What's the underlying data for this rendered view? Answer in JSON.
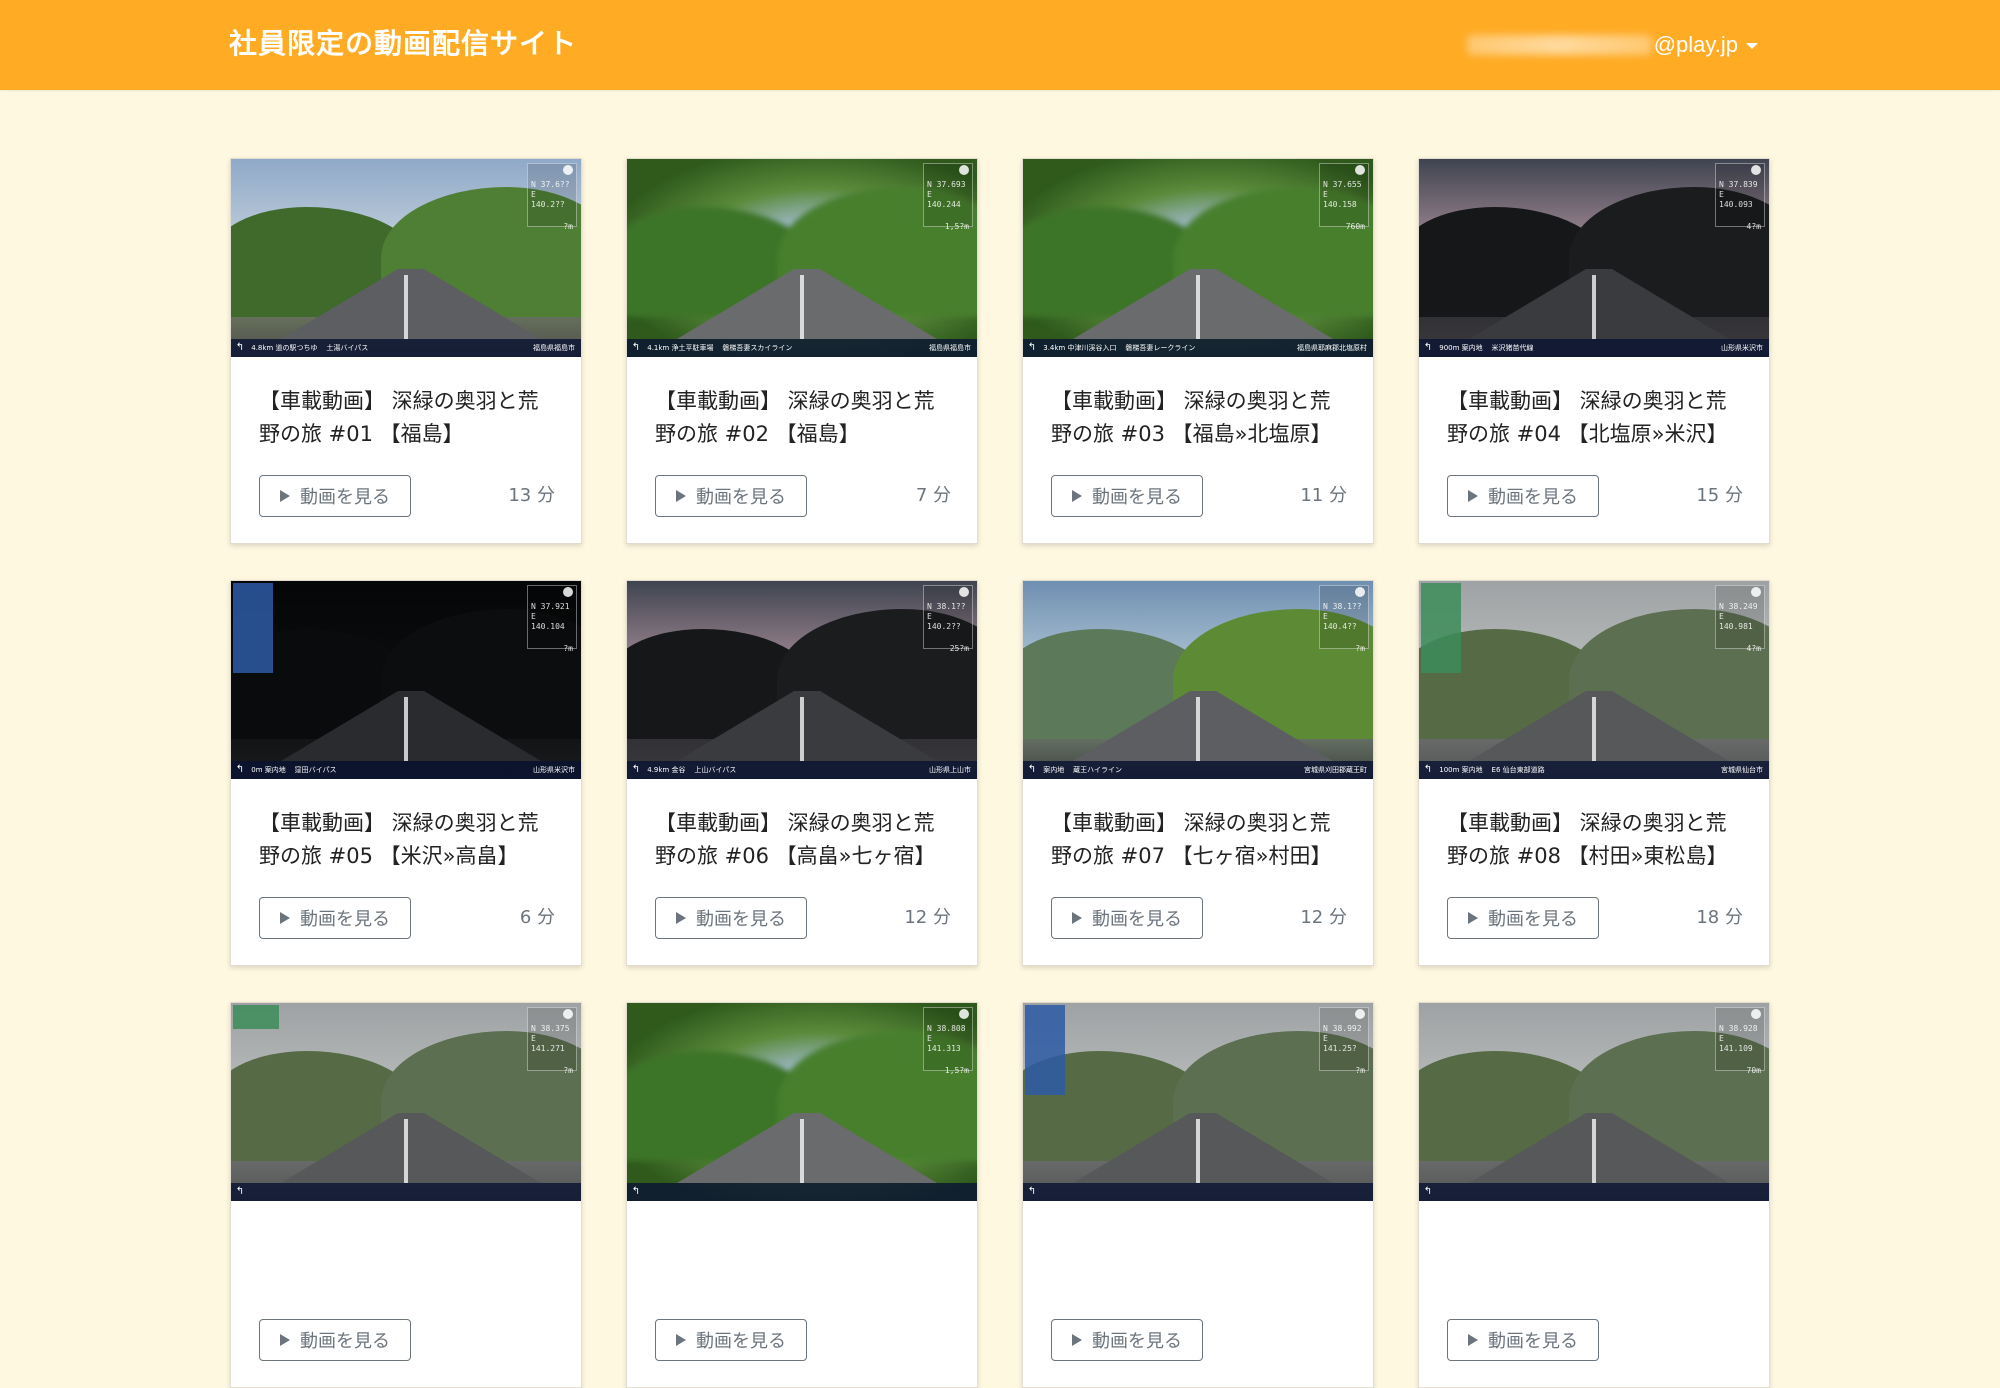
{
  "header": {
    "brand": "社員限定の動画配信サイト",
    "user_email_domain": "@play.jp",
    "bg_color": "#ffab24"
  },
  "page": {
    "bg_color": "#fff8e1"
  },
  "button_label": "動画を見る",
  "videos": [
    {
      "title": "【車載動画】 深緑の奥羽と荒野の旅 #01 【福島】",
      "duration": "13 分",
      "thumb": "t-day",
      "hud_lat": "N 37.6??",
      "hud_lon": "E 140.2??",
      "hud_alt": "?m",
      "hud_bottom_left": "4.8km 道の駅つちゆ",
      "hud_bottom_mid": "土湯バイパス",
      "hud_bottom_right": "福島県福島市"
    },
    {
      "title": "【車載動画】 深緑の奥羽と荒野の旅 #02 【福島】",
      "duration": "7 分",
      "thumb": "t-blur",
      "hud_lat": "N 37.693",
      "hud_lon": "E 140.244",
      "hud_alt": "1,5?m",
      "hud_bottom_left": "4.1km 浄土平駐車場",
      "hud_bottom_mid": "磐梯吾妻スカイライン",
      "hud_bottom_right": "福島県福島市"
    },
    {
      "title": "【車載動画】 深緑の奥羽と荒野の旅 #03 【福島»北塩原】",
      "duration": "11 分",
      "thumb": "t-blur",
      "hud_lat": "N 37.655",
      "hud_lon": "E 140.158",
      "hud_alt": "760m",
      "hud_bottom_left": "3.4km 中津川渓谷入口",
      "hud_bottom_mid": "磐梯吾妻レークライン",
      "hud_bottom_right": "福島県耶麻郡北塩原村"
    },
    {
      "title": "【車載動画】 深緑の奥羽と荒野の旅 #04 【北塩原»米沢】",
      "duration": "15 分",
      "thumb": "t-dusk",
      "hud_lat": "N 37.839",
      "hud_lon": "E 140.093",
      "hud_alt": "4?m",
      "hud_bottom_left": "900m 案内地",
      "hud_bottom_mid": "米沢猪苗代線",
      "hud_bottom_right": "山形県米沢市"
    },
    {
      "title": "【車載動画】 深緑の奥羽と荒野の旅 #05 【米沢»高畠】",
      "duration": "6 分",
      "thumb": "t-night",
      "hud_lat": "N 37.921",
      "hud_lon": "E 140.104",
      "hud_alt": "?m",
      "hud_bottom_left": "0m 案内地",
      "hud_bottom_mid": "窪田バイパス",
      "hud_bottom_right": "山形県米沢市"
    },
    {
      "title": "【車載動画】 深緑の奥羽と荒野の旅 #06 【高畠»七ヶ宿】",
      "duration": "12 分",
      "thumb": "t-dusk",
      "hud_lat": "N 38.1??",
      "hud_lon": "E 140.2??",
      "hud_alt": "25?m",
      "hud_bottom_left": "4.9km 金谷",
      "hud_bottom_mid": "上山バイパス",
      "hud_bottom_right": "山形県上山市"
    },
    {
      "title": "【車載動画】 深緑の奥羽と荒野の旅 #07 【七ヶ宿»村田】",
      "duration": "12 分",
      "thumb": "t-valley",
      "hud_lat": "N 38.1??",
      "hud_lon": "E 140.4??",
      "hud_alt": "?m",
      "hud_bottom_left": "案内地",
      "hud_bottom_mid": "蔵王ハイライン",
      "hud_bottom_right": "宮城県刈田郡蔵王町"
    },
    {
      "title": "【車載動画】 深緑の奥羽と荒野の旅 #08 【村田»東松島】",
      "duration": "18 分",
      "thumb": "t-grey",
      "hud_lat": "N 38.249",
      "hud_lon": "E 140.981",
      "hud_alt": "4?m",
      "hud_bottom_left": "100m 案内地",
      "hud_bottom_mid": "E6 仙台東部道路",
      "hud_bottom_right": "宮城県仙台市"
    },
    {
      "title": "",
      "duration": "",
      "thumb": "t-grey",
      "hud_lat": "N 38.375",
      "hud_lon": "E 141.271",
      "hud_alt": "?m",
      "hud_bottom_left": "",
      "hud_bottom_mid": "",
      "hud_bottom_right": ""
    },
    {
      "title": "",
      "duration": "",
      "thumb": "t-blur",
      "hud_lat": "N 38.808",
      "hud_lon": "E 141.313",
      "hud_alt": "1,5?m",
      "hud_bottom_left": "",
      "hud_bottom_mid": "",
      "hud_bottom_right": ""
    },
    {
      "title": "",
      "duration": "",
      "thumb": "t-grey",
      "hud_lat": "N 38.992",
      "hud_lon": "E 141.25?",
      "hud_alt": "?m",
      "hud_bottom_left": "",
      "hud_bottom_mid": "",
      "hud_bottom_right": ""
    },
    {
      "title": "",
      "duration": "",
      "thumb": "t-grey",
      "hud_lat": "N 38.928",
      "hud_lon": "E 141.109",
      "hud_alt": "70m",
      "hud_bottom_left": "",
      "hud_bottom_mid": "",
      "hud_bottom_right": ""
    }
  ]
}
